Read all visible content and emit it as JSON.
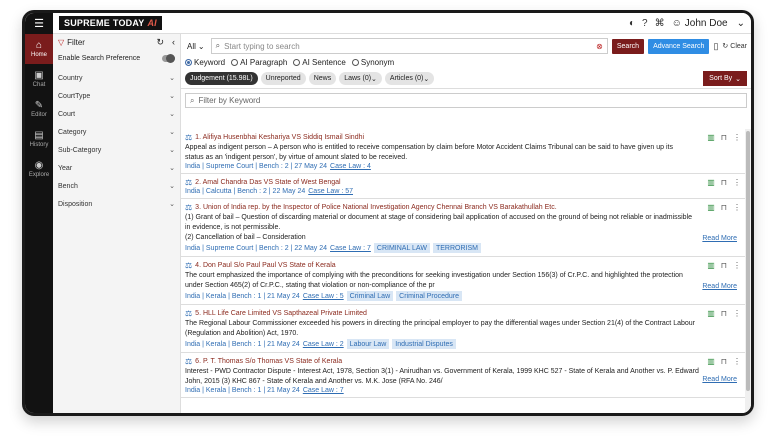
{
  "brand": {
    "name": "SUPREME",
    "name2": "TODAY",
    "suffix": "AI"
  },
  "header": {
    "user_name": "John Doe"
  },
  "sidenav": [
    {
      "label": "Home",
      "icon": "home-icon",
      "glyph": "⌂"
    },
    {
      "label": "Chat",
      "icon": "chat-icon",
      "glyph": "▣"
    },
    {
      "label": "Editor",
      "icon": "editor-icon",
      "glyph": "✎"
    },
    {
      "label": "History",
      "icon": "history-icon",
      "glyph": "▤"
    },
    {
      "label": "Explore",
      "icon": "explore-icon",
      "glyph": "◉"
    }
  ],
  "filters": {
    "title": "Filter",
    "preference_label": "Enable Search Preference",
    "items": [
      "Country",
      "CourtType",
      "Court",
      "Category",
      "Sub-Category",
      "Year",
      "Bench",
      "Disposition"
    ]
  },
  "search": {
    "scope": "All",
    "placeholder": "Start typing to search",
    "search_label": "Search",
    "advanced_label": "Advance Search",
    "clear_label": "Clear"
  },
  "modes": [
    "Keyword",
    "AI Paragraph",
    "AI Sentence",
    "Synonym"
  ],
  "tabs": [
    "Judgement (15.98L)",
    "Unreported",
    "News",
    "Laws (0)",
    "Articles (0)"
  ],
  "sort_label": "Sort By",
  "keyword_filter_placeholder": "Filter by Keyword",
  "read_more_label": "Read More",
  "results": [
    {
      "title": "1. Alifiya Husenbhai Keshariya VS Siddiq Ismail Sindhi",
      "lines": [
        "Appeal as indigent person – A person who is entitled to receive compensation by claim before Motor Accident Claims Tribunal can be said to have given up its",
        "status as an 'indigent person', by virtue of amount slated to be received."
      ],
      "meta": "India | Supreme Court | Bench : 2 | 27 May 24",
      "case_law": "Case Law : 4",
      "tags": [],
      "read_more": false
    },
    {
      "title": "2. Amal Chandra Das VS State of West Bengal",
      "lines": [],
      "meta": "India | Calcutta | Bench : 2 | 22 May 24",
      "case_law": "Case Law : 57",
      "tags": [],
      "read_more": false
    },
    {
      "title": "3. Union of India rep. by the Inspector of Police National Investigation Agency Chennai Branch VS Barakathullah Etc.",
      "lines": [
        "(1) Grant of bail – Question of discarding material or document at stage of considering bail application of accused on the ground of being not reliable or inadmissible",
        "in evidence, is not permissible.",
        "(2) Cancellation of bail – Consideration"
      ],
      "meta": "India | Supreme Court | Bench : 2 | 22 May 24",
      "case_law": "Case Law : 7",
      "tags": [
        "CRIMINAL LAW",
        "TERRORISM"
      ],
      "read_more": true
    },
    {
      "title": "4. Don Paul S/o Paul Paul VS State of Kerala",
      "lines": [
        "The court emphasized the importance of complying with the preconditions for seeking investigation under Section 156(3) of Cr.P.C. and highlighted the protection",
        "under Section 465(2) of Cr.P.C., stating that violation or non-compliance of the pr"
      ],
      "meta": "India | Kerala | Bench : 1 | 21 May 24",
      "case_law": "Case Law : 5",
      "tags": [
        "Criminal Law",
        "Criminal Procedure"
      ],
      "read_more": true
    },
    {
      "title": "5. HLL Life Care Limited VS Sapthazeal Private Limited",
      "lines": [
        "The Regional Labour Commissioner exceeded his powers in directing the principal employer to pay the differential wages under Section 21(4) of the Contract Labour",
        "(Regulation and Abolition) Act, 1970."
      ],
      "meta": "India | Kerala | Bench : 1 | 21 May 24",
      "case_law": "Case Law : 2",
      "tags": [
        "Labour Law",
        "Industrial Disputes"
      ],
      "read_more": false
    },
    {
      "title": "6. P. T. Thomas S/o Thomas VS State of Kerala",
      "lines": [
        "Interest - PWD Contractor Dispute - Interest Act, 1978, Section 3(1) - Anirudhan vs. Government of Kerala, 1999 KHC 527 - State of Kerala and Another vs. P. Edward",
        "John, 2015 (3) KHC 867 - State of Kerala and Another vs. M.K. Jose (RFA No. 246/"
      ],
      "meta": "India | Kerala | Bench : 1 | 21 May 24",
      "case_law": "Case Law : 7",
      "tags": [],
      "read_more": true
    }
  ]
}
